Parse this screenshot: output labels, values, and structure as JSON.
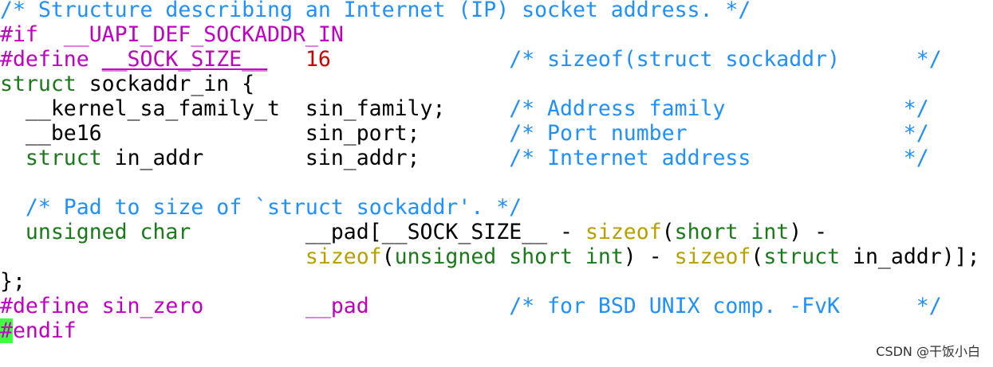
{
  "colors": {
    "background": "#ffffff",
    "comment": "#1e90ff",
    "preprocessor": "#c000c0",
    "number": "#d40000",
    "type_keyword": "#1a7a1a",
    "function": "#b8a000",
    "plain": "#000000",
    "cursor_bg": "#40ff40"
  },
  "code_lines": [
    {
      "segments": [
        {
          "text": "/* Structure describing an Internet (IP) socket address. */",
          "style": "comment"
        }
      ]
    },
    {
      "segments": [
        {
          "text": "#if  ",
          "style": "preproc"
        },
        {
          "text": "__UAPI_DEF_SOCKADDR_IN",
          "style": "preproc"
        }
      ]
    },
    {
      "segments": [
        {
          "text": "#define ",
          "style": "preproc"
        },
        {
          "text": "__SOCK_SIZE__",
          "style": "preproc-underline"
        },
        {
          "text": "   ",
          "style": "plain"
        },
        {
          "text": "16",
          "style": "number"
        },
        {
          "text": "              ",
          "style": "plain"
        },
        {
          "text": "/* sizeof(struct sockaddr)      */",
          "style": "comment"
        }
      ]
    },
    {
      "segments": [
        {
          "text": "struct",
          "style": "type"
        },
        {
          "text": " sockaddr_in {",
          "style": "plain"
        }
      ]
    },
    {
      "segments": [
        {
          "text": "  __kernel_sa_family_t  sin_family;     ",
          "style": "plain"
        },
        {
          "text": "/* Address family              */",
          "style": "comment"
        }
      ]
    },
    {
      "segments": [
        {
          "text": "  __be16                sin_port;       ",
          "style": "plain"
        },
        {
          "text": "/* Port number                 */",
          "style": "comment"
        }
      ]
    },
    {
      "segments": [
        {
          "text": "  ",
          "style": "plain"
        },
        {
          "text": "struct",
          "style": "type"
        },
        {
          "text": " in_addr        sin_addr;       ",
          "style": "plain"
        },
        {
          "text": "/* Internet address            */",
          "style": "comment"
        }
      ]
    },
    {
      "segments": [
        {
          "text": "",
          "style": "plain"
        }
      ]
    },
    {
      "segments": [
        {
          "text": "  ",
          "style": "plain"
        },
        {
          "text": "/* Pad to size of `struct sockaddr'. */",
          "style": "comment"
        }
      ]
    },
    {
      "segments": [
        {
          "text": "  ",
          "style": "plain"
        },
        {
          "text": "unsigned char",
          "style": "type"
        },
        {
          "text": "         __pad[__SOCK_SIZE__ - ",
          "style": "plain"
        },
        {
          "text": "sizeof",
          "style": "func"
        },
        {
          "text": "(",
          "style": "plain"
        },
        {
          "text": "short int",
          "style": "type"
        },
        {
          "text": ") -",
          "style": "plain"
        }
      ]
    },
    {
      "segments": [
        {
          "text": "                        ",
          "style": "plain"
        },
        {
          "text": "sizeof",
          "style": "func"
        },
        {
          "text": "(",
          "style": "plain"
        },
        {
          "text": "unsigned short int",
          "style": "type"
        },
        {
          "text": ") - ",
          "style": "plain"
        },
        {
          "text": "sizeof",
          "style": "func"
        },
        {
          "text": "(",
          "style": "plain"
        },
        {
          "text": "struct",
          "style": "type"
        },
        {
          "text": " in_addr)];",
          "style": "plain"
        }
      ]
    },
    {
      "segments": [
        {
          "text": "};",
          "style": "plain"
        }
      ]
    },
    {
      "segments": [
        {
          "text": "#define sin_zero",
          "style": "preproc"
        },
        {
          "text": "        ",
          "style": "plain"
        },
        {
          "text": "__pad",
          "style": "preproc"
        },
        {
          "text": "           ",
          "style": "plain"
        },
        {
          "text": "/* for BSD UNIX comp. -FvK      */",
          "style": "comment"
        }
      ]
    },
    {
      "segments": [
        {
          "text": "#",
          "style": "cursor"
        },
        {
          "text": "endif",
          "style": "preproc"
        }
      ]
    }
  ],
  "watermark": "CSDN @干饭小白"
}
